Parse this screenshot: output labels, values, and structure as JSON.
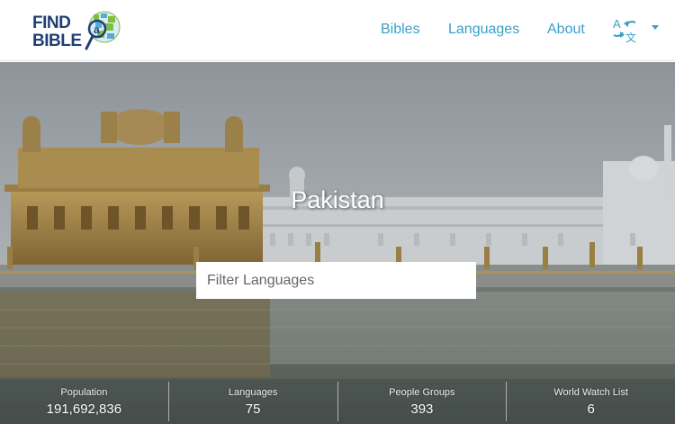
{
  "header": {
    "logo_line1": "FIND",
    "logo_line2": "BIBLE",
    "nav": {
      "bibles": "Bibles",
      "languages": "Languages",
      "about": "About"
    },
    "language_switch": {
      "glyph_latin": "A",
      "glyph_cjk": "文",
      "icon": "translate-icon",
      "dropdown_icon": "caret-down-icon"
    }
  },
  "hero": {
    "country": "Pakistan",
    "filter_placeholder": "Filter Languages"
  },
  "stats": [
    {
      "label": "Population",
      "value": "191,692,836"
    },
    {
      "label": "Languages",
      "value": "75"
    },
    {
      "label": "People Groups",
      "value": "393"
    },
    {
      "label": "World Watch List",
      "value": "6"
    }
  ],
  "colors": {
    "nav_link": "#3a9fc9",
    "logo_blue": "#1f3f73",
    "logo_green": "#7fbf3f"
  }
}
